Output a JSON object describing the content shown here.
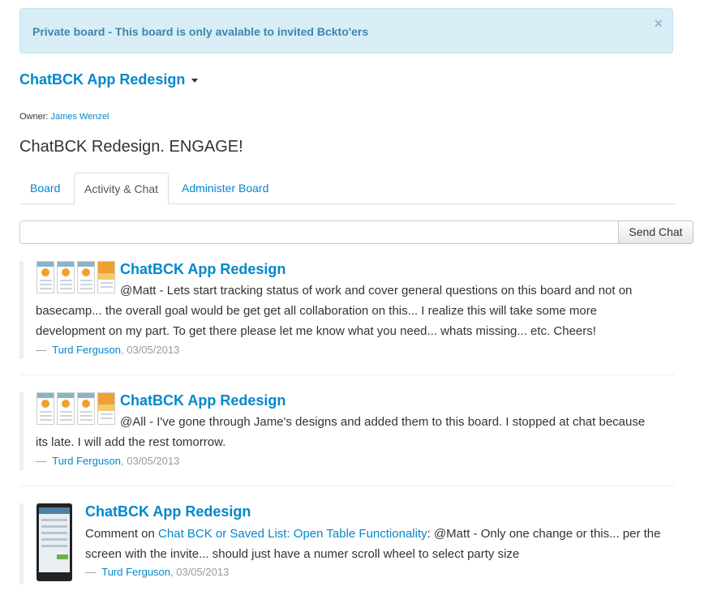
{
  "alert": {
    "text": "Private board - This board is only avalable to invited Bckto'ers",
    "close_glyph": "×"
  },
  "board": {
    "title": "ChatBCK App Redesign",
    "owner_label": "Owner:",
    "owner_name": "James Wenzel",
    "description": "ChatBCK Redesign. ENGAGE!"
  },
  "tabs": [
    {
      "label": "Board",
      "active": false
    },
    {
      "label": "Activity & Chat",
      "active": true
    },
    {
      "label": "Administer Board",
      "active": false
    }
  ],
  "chat": {
    "input_value": "",
    "send_label": "Send Chat"
  },
  "posts": [
    {
      "title": "ChatBCK App Redesign",
      "body_line1": "@Matt - Lets start tracking status of work and cover general questions on this board and not on",
      "body_rest": "basecamp... the overall goal would be get get all collaboration on this... I realize this will take some more development on my part. To get there please let me know what you need... whats missing... etc. Cheers!",
      "dash": "—",
      "author": "Turd Ferguson",
      "date": ", 03/05/2013"
    },
    {
      "title": "ChatBCK App Redesign",
      "body_line1": "@All - I've gone through Jame's designs and added them to this board. I stopped at chat because",
      "body_rest": "its late. I will add the rest tomorrow.",
      "dash": "—",
      "author": "Turd Ferguson",
      "date": ", 03/05/2013"
    },
    {
      "title": "ChatBCK App Redesign",
      "comment_prefix": "Comment on ",
      "comment_link": "Chat BCK or Saved List: Open Table Functionality",
      "comment_text": ": @Matt - Only one change or this... per the screen with the invite... should just have a numer scroll wheel to select party size",
      "dash": "—",
      "author": "Turd Ferguson",
      "date": ", 03/05/2013"
    }
  ],
  "colors": {
    "link": "#0088cc",
    "alert_bg": "#d9edf7",
    "alert_text": "#3a87ad",
    "muted": "#999999"
  }
}
